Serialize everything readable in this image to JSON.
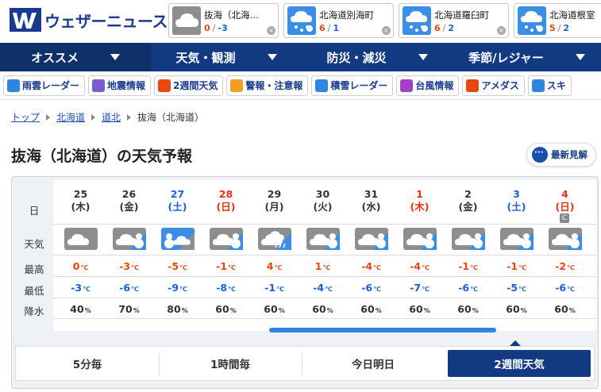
{
  "brand": {
    "logo_text": "ウェザーニュース",
    "logo_mark": "WN"
  },
  "locations": [
    {
      "name": "抜海（北海…",
      "hi": "0",
      "sep": "/",
      "lo": "-3",
      "icon": "cloud-icon",
      "color": "#8e8e8e"
    },
    {
      "name": "北海道別海町",
      "hi": "6",
      "sep": "/",
      "lo": "1",
      "icon": "snow-icon",
      "color": "#3a8ee6"
    },
    {
      "name": "北海道羅臼町",
      "hi": "6",
      "sep": "/",
      "lo": "2",
      "icon": "snow-icon",
      "color": "#3a8ee6"
    },
    {
      "name": "北海道根室",
      "hi": "5",
      "sep": "/",
      "lo": "2",
      "icon": "snow-icon",
      "color": "#3a8ee6"
    }
  ],
  "close_glyph": "×",
  "nav": [
    {
      "label": "オススメ",
      "active": true
    },
    {
      "label": "天気・観測"
    },
    {
      "label": "防災・減災"
    },
    {
      "label": "季節/レジャー"
    }
  ],
  "subnav": [
    {
      "label": "雨雲レーダー",
      "icon": "umbrella-icon",
      "color": "#2f86e0"
    },
    {
      "label": "地震情報",
      "icon": "house-icon",
      "color": "#7a5bd1"
    },
    {
      "label": "2週間天気",
      "icon": "calendar-icon",
      "color": "#e8470f"
    },
    {
      "label": "警報・注意報",
      "icon": "warning-icon",
      "color": "#f0a020"
    },
    {
      "label": "積雪レーダー",
      "icon": "snowman-icon",
      "color": "#2f86e0"
    },
    {
      "label": "台風情報",
      "icon": "typhoon-icon",
      "color": "#a040c8"
    },
    {
      "label": "アメダス",
      "icon": "graph-icon",
      "color": "#e8470f"
    },
    {
      "label": "スキ",
      "icon": "ski-icon",
      "color": "#2f86e0"
    }
  ],
  "breadcrumb": [
    "トップ",
    "北海道",
    "道北",
    "抜海（北海道）"
  ],
  "page_title": "抜海（北海道）の天気予報",
  "latest_label": "最新見解",
  "row_labels": {
    "day": "日",
    "weather": "天気",
    "high": "最高",
    "low": "最低",
    "rain": "降水"
  },
  "temp_unit": "℃",
  "pct_unit": "%",
  "days": [
    {
      "d": "25",
      "w": "(木)",
      "kind": "cloud",
      "hi": "0",
      "lo": "-3",
      "p": "40",
      "type": "weekday"
    },
    {
      "d": "26",
      "w": "(金)",
      "kind": "cloud-snow",
      "hi": "-3",
      "lo": "-6",
      "p": "70",
      "type": "weekday"
    },
    {
      "d": "27",
      "w": "(土)",
      "kind": "snow-cloud",
      "hi": "-5",
      "lo": "-9",
      "p": "80",
      "type": "sat"
    },
    {
      "d": "28",
      "w": "(日)",
      "kind": "cloud-snow",
      "hi": "-1",
      "lo": "-8",
      "p": "60",
      "type": "sun"
    },
    {
      "d": "29",
      "w": "(月)",
      "kind": "cloud-rain",
      "hi": "4",
      "lo": "-1",
      "p": "60",
      "type": "weekday"
    },
    {
      "d": "30",
      "w": "(火)",
      "kind": "cloud-snow",
      "hi": "1",
      "lo": "-4",
      "p": "60",
      "type": "weekday"
    },
    {
      "d": "31",
      "w": "(水)",
      "kind": "cloud-snow",
      "hi": "-4",
      "lo": "-6",
      "p": "60",
      "type": "weekday"
    },
    {
      "d": "1",
      "w": "(木)",
      "kind": "cloud-snow",
      "hi": "-4",
      "lo": "-7",
      "p": "60",
      "type": "sun"
    },
    {
      "d": "2",
      "w": "(金)",
      "kind": "cloud-snow",
      "hi": "-1",
      "lo": "-6",
      "p": "60",
      "type": "weekday"
    },
    {
      "d": "3",
      "w": "(土)",
      "kind": "cloud-snow",
      "hi": "-1",
      "lo": "-5",
      "p": "60",
      "type": "sat"
    },
    {
      "d": "4",
      "w": "(日)",
      "kind": "cloud-snow",
      "hi": "-2",
      "lo": "-6",
      "p": "60",
      "type": "sun",
      "badge": "C"
    }
  ],
  "tabs": [
    {
      "label": "5分毎"
    },
    {
      "label": "1時間毎"
    },
    {
      "label": "今日明日"
    },
    {
      "label": "2週間天気",
      "active": true
    }
  ]
}
